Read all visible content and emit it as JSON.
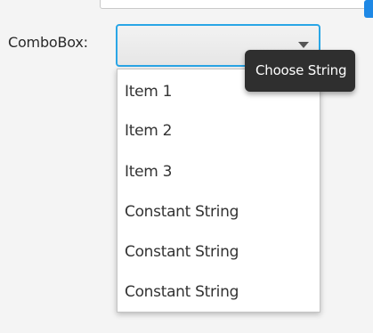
{
  "combobox": {
    "label": "ComboBox:",
    "selected_value": "",
    "tooltip": "Choose String",
    "options": [
      "Item 1",
      "Item 2",
      "Item 3",
      "Constant String",
      "Constant String",
      "Constant String"
    ]
  },
  "colors": {
    "focus_border": "#2aa6e6",
    "tooltip_bg": "#2f2f2f",
    "accent": "#1e88e5"
  }
}
